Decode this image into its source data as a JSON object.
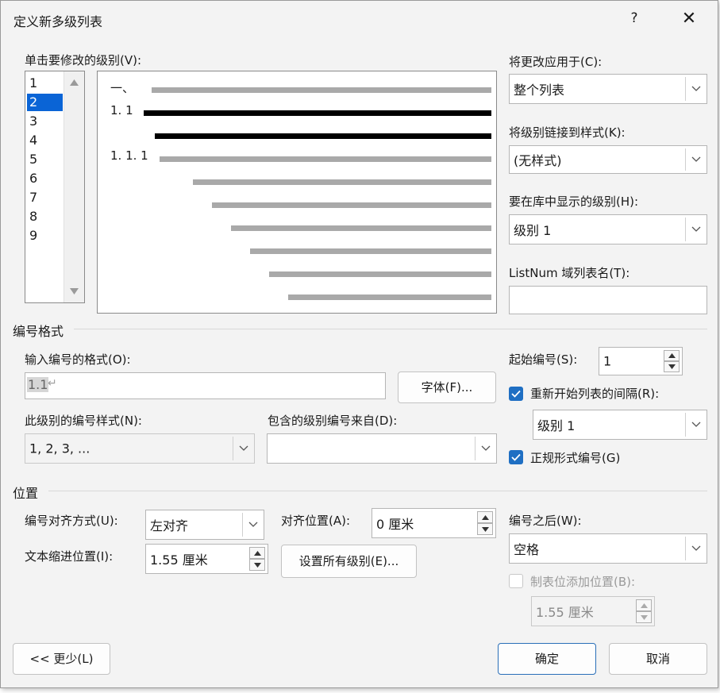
{
  "dialog": {
    "title": "定义新多级列表",
    "help": "?",
    "close": "✕"
  },
  "levels": {
    "label": "单击要修改的级别(V):",
    "items": [
      "1",
      "2",
      "3",
      "4",
      "5",
      "6",
      "7",
      "8",
      "9"
    ],
    "selected": "2"
  },
  "preview": {
    "labels": [
      "一、",
      "1. 1",
      "1. 1. 1"
    ]
  },
  "apply_to": {
    "label": "将更改应用于(C):",
    "value": "整个列表"
  },
  "link_style": {
    "label": "将级别链接到样式(K):",
    "value": "(无样式)"
  },
  "gallery_level": {
    "label": "要在库中显示的级别(H):",
    "value": "级别 1"
  },
  "listnum": {
    "label": "ListNum 域列表名(T):",
    "value": ""
  },
  "number_format": {
    "section": "编号格式",
    "format_label": "输入编号的格式(O):",
    "format_value": "1.1",
    "format_mark": "↵",
    "font_button": "字体(F)...",
    "style_label": "此级别的编号样式(N):",
    "style_value": "1, 2, 3, ...",
    "include_label": "包含的级别编号来自(D):",
    "include_value": "",
    "start_label": "起始编号(S):",
    "start_value": "1",
    "restart_label": "重新开始列表的间隔(R):",
    "restart_checked": true,
    "restart_value": "级别 1",
    "legal_label": "正规形式编号(G)",
    "legal_checked": true
  },
  "position": {
    "section": "位置",
    "align_label": "编号对齐方式(U):",
    "align_value": "左对齐",
    "at_label": "对齐位置(A):",
    "at_value": "0 厘米",
    "indent_label": "文本缩进位置(I):",
    "indent_value": "1.55 厘米",
    "set_all_button": "设置所有级别(E)...",
    "follow_label": "编号之后(W):",
    "follow_value": "空格",
    "tabstop_label": "制表位添加位置(B):",
    "tabstop_checked": false,
    "tabstop_value": "1.55 厘米"
  },
  "footer": {
    "less": "<< 更少(L)",
    "ok": "确定",
    "cancel": "取消"
  },
  "colors": {
    "accent": "#1f6fc3",
    "selection": "#0a64d6"
  }
}
